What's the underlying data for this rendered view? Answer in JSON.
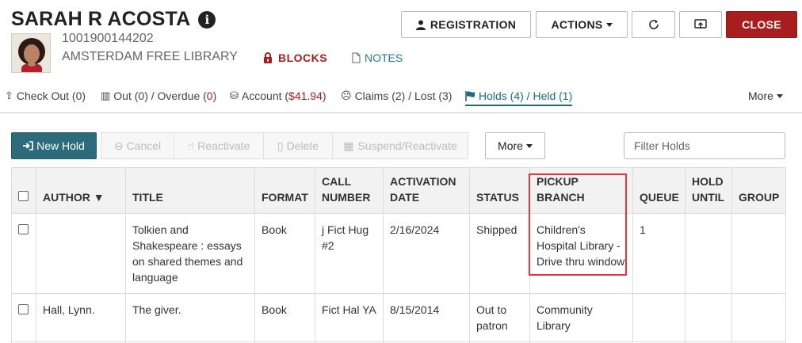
{
  "patron": {
    "name": "SARAH R ACOSTA",
    "barcode": "1001900144202",
    "library": "AMSTERDAM FREE LIBRARY",
    "blocks_label": "BLOCKS",
    "notes_label": "NOTES"
  },
  "header_buttons": {
    "registration": "REGISTRATION",
    "actions": "ACTIONS",
    "close": "CLOSE"
  },
  "tabs": {
    "checkout": "Check Out (0)",
    "out_prefix": "Out (0) / Overdue (",
    "out_count": "0",
    "out_suffix": ")",
    "account_prefix": "Account (",
    "account_amount": "$41.94",
    "account_suffix": ")",
    "claims": "Claims (2) / Lost (3)",
    "holds": "Holds (4) / Held (1)",
    "more": "More"
  },
  "toolbar": {
    "new_hold": "New Hold",
    "cancel": "Cancel",
    "reactivate": "Reactivate",
    "delete": "Delete",
    "suspend": "Suspend/Reactivate",
    "more": "More",
    "filter_placeholder": "Filter Holds"
  },
  "table": {
    "headers": {
      "author": "AUTHOR ▼",
      "title": "TITLE",
      "format": "FORMAT",
      "call_number": "CALL NUMBER",
      "activation_date": "ACTIVATION DATE",
      "status": "STATUS",
      "pickup_branch": "PICKUP BRANCH",
      "queue": "QUEUE",
      "hold_until": "HOLD UNTIL",
      "group": "GROUP"
    },
    "rows": [
      {
        "author": "",
        "title": "Tolkien and Shakespeare : essays on shared themes and language",
        "format": "Book",
        "call_number": "j Fict Hug #2",
        "activation_date": "2/16/2024",
        "status": "Shipped",
        "pickup_branch": "Children's Hospital Library - Drive thru window",
        "queue": "1",
        "hold_until": "",
        "group": ""
      },
      {
        "author": "Hall, Lynn.",
        "title": "The giver.",
        "format": "Book",
        "call_number": "Fict Hal YA",
        "activation_date": "8/15/2014",
        "status": "Out to patron",
        "pickup_branch": "Community Library",
        "queue": "",
        "hold_until": "",
        "group": ""
      }
    ]
  },
  "colors": {
    "accent": "#2b6b7a",
    "danger": "#a81e1e",
    "highlight": "#e0373f"
  }
}
